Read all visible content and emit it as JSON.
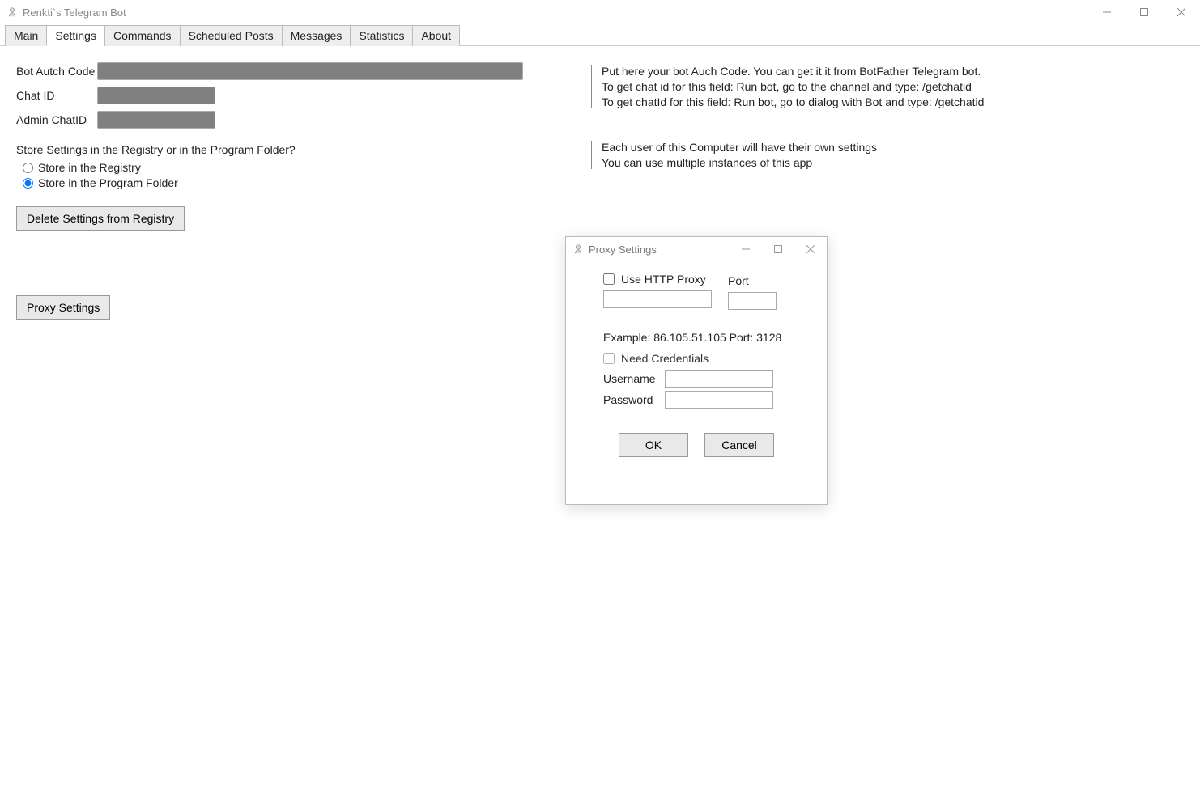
{
  "window": {
    "title": "Renkti`s Telegram Bot"
  },
  "tabs": [
    "Main",
    "Settings",
    "Commands",
    "Scheduled Posts",
    "Messages",
    "Statistics",
    "About"
  ],
  "active_tab": 1,
  "form": {
    "auth_label": "Bot Autch Code",
    "auth_value": "████████████████████████████████████████",
    "chat_label": "Chat ID",
    "chat_value": "██████████",
    "admin_label": "Admin ChatID",
    "admin_value": "████████",
    "store_question": "Store Settings in the Registry or in the Program Folder?",
    "store_registry": "Store in the Registry",
    "store_folder": "Store in the Program Folder",
    "store_selected": "folder",
    "delete_btn": "Delete Settings from Registry",
    "proxy_btn": "Proxy Settings"
  },
  "info1": [
    "Put here your bot Auch Code. You can get it it from BotFather Telegram bot.",
    "To get chat id for this field: Run bot, go to the channel and type: /getchatid",
    "To get chatId for this field: Run bot, go to dialog with Bot and type: /getchatid"
  ],
  "info2": [
    "Each user of this Computer will have their own settings",
    "You can use multiple instances of this app"
  ],
  "dialog": {
    "title": "Proxy Settings",
    "use_http": "Use HTTP Proxy",
    "port_label": "Port",
    "host_value": "",
    "port_value": "",
    "example": "Example: 86.105.51.105  Port: 3128",
    "need_creds": "Need Credentials",
    "username_label": "Username",
    "password_label": "Password",
    "username_value": "",
    "password_value": "",
    "ok": "OK",
    "cancel": "Cancel"
  }
}
